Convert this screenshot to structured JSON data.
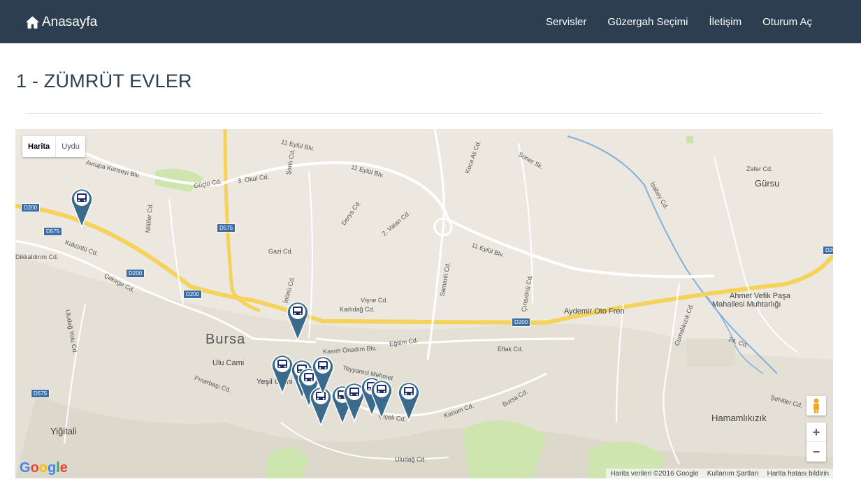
{
  "nav": {
    "brand": "Anasayfa",
    "links": [
      "Servisler",
      "Güzergah Seçimi",
      "İletişim",
      "Oturum Aç"
    ]
  },
  "page_title": "1 - ZÜMRÜT EVLER",
  "map": {
    "type_buttons": [
      "Harita",
      "Uydu"
    ],
    "zoom_in": "+",
    "zoom_out": "−",
    "logo": "Google",
    "attribution": [
      "Harita verileri ©2016 Google",
      "Kullanım Şartları",
      "Harita hatası bildirin"
    ],
    "city_label": "Bursa",
    "towns": [
      "Gürsu",
      "Yiğitali",
      "Hamamlıkızık"
    ],
    "places": [
      "Ulu Cami",
      "Yeşil Cami",
      "Aydemir Oto Fren",
      "Ahmet Vefik Paşa",
      "Mahallesi Muhtarlığı"
    ],
    "highways": [
      "D200",
      "D575"
    ],
    "streets": [
      "11 Eylül Blv.",
      "Avrupa Konseyi Blv.",
      "Güçlü Cd.",
      "3. Okul Cd.",
      "Kükürtlü Cd.",
      "Dikkaldırım Cd.",
      "Çekirge Cd.",
      "Gazi Cd.",
      "Derya Cd.",
      "2. Vatan Cd.",
      "Vişne Cd.",
      "Karlıdağ Cd.",
      "Kasım Önadım Blv.",
      "Eğitim Cd.",
      "Eflak Cd.",
      "Çiçek Cd.",
      "Kanum Cd.",
      "Bursa Cd.",
      "Uludağ Cd.",
      "Pınarbaşı Cd.",
      "Samanlı Cd.",
      "Çınarönü Cd.",
      "İnönü Cd.",
      "Şanlı Cd.",
      "Nilüfer Cd.",
      "Zafer Cd.",
      "İsabey Cd.",
      "Cumalıkızık Cd.",
      "24. Cd.",
      "Şehitler Cd.",
      "Uludağ Yolu Cd.",
      "Teyyareci Mehmet",
      "Koca Ali Cd.",
      "Soner Sk."
    ],
    "marker_icon": "bus-icon",
    "marker_color": "#3b6b8c",
    "stop_count": 12
  }
}
